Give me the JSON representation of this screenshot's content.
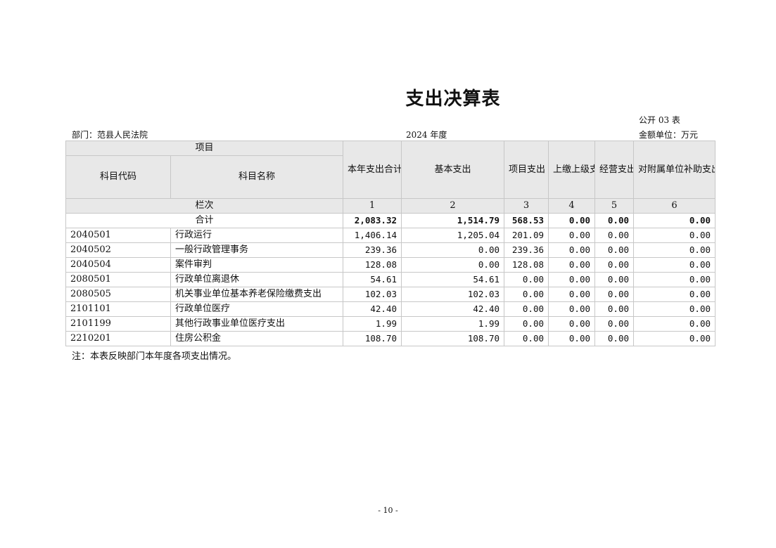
{
  "title": "支出决算表",
  "form_code": "公开 03 表",
  "department": "部门：范县人民法院",
  "year": "2024 年度",
  "unit": "金额单位：万元",
  "table": {
    "header_group": "项目",
    "col_code": "科目代码",
    "col_name": "科目名称",
    "col_total": "本年支出合计",
    "col_basic": "基本支出",
    "col_project": "项目支出",
    "col_upper": "上缴上级支出",
    "col_business": "经营支出",
    "col_subsidy": "对附属单位补助支出",
    "index_label": "栏次",
    "index_values": [
      "1",
      "2",
      "3",
      "4",
      "5",
      "6"
    ],
    "total_row": {
      "label": "合计",
      "values": [
        "2,083.32",
        "1,514.79",
        "568.53",
        "0.00",
        "0.00",
        "0.00"
      ]
    },
    "rows": [
      {
        "code": "2040501",
        "name": "行政运行",
        "values": [
          "1,406.14",
          "1,205.04",
          "201.09",
          "0.00",
          "0.00",
          "0.00"
        ]
      },
      {
        "code": "2040502",
        "name": "一般行政管理事务",
        "values": [
          "239.36",
          "0.00",
          "239.36",
          "0.00",
          "0.00",
          "0.00"
        ]
      },
      {
        "code": "2040504",
        "name": "案件审判",
        "values": [
          "128.08",
          "0.00",
          "128.08",
          "0.00",
          "0.00",
          "0.00"
        ]
      },
      {
        "code": "2080501",
        "name": "行政单位离退休",
        "values": [
          "54.61",
          "54.61",
          "0.00",
          "0.00",
          "0.00",
          "0.00"
        ]
      },
      {
        "code": "2080505",
        "name": "机关事业单位基本养老保险缴费支出",
        "values": [
          "102.03",
          "102.03",
          "0.00",
          "0.00",
          "0.00",
          "0.00"
        ]
      },
      {
        "code": "2101101",
        "name": "行政单位医疗",
        "values": [
          "42.40",
          "42.40",
          "0.00",
          "0.00",
          "0.00",
          "0.00"
        ]
      },
      {
        "code": "2101199",
        "name": "其他行政事业单位医疗支出",
        "values": [
          "1.99",
          "1.99",
          "0.00",
          "0.00",
          "0.00",
          "0.00"
        ]
      },
      {
        "code": "2210201",
        "name": "住房公积金",
        "values": [
          "108.70",
          "108.70",
          "0.00",
          "0.00",
          "0.00",
          "0.00"
        ]
      }
    ]
  },
  "note": "注：本表反映部门本年度各项支出情况。",
  "page_number": "- 10 -"
}
